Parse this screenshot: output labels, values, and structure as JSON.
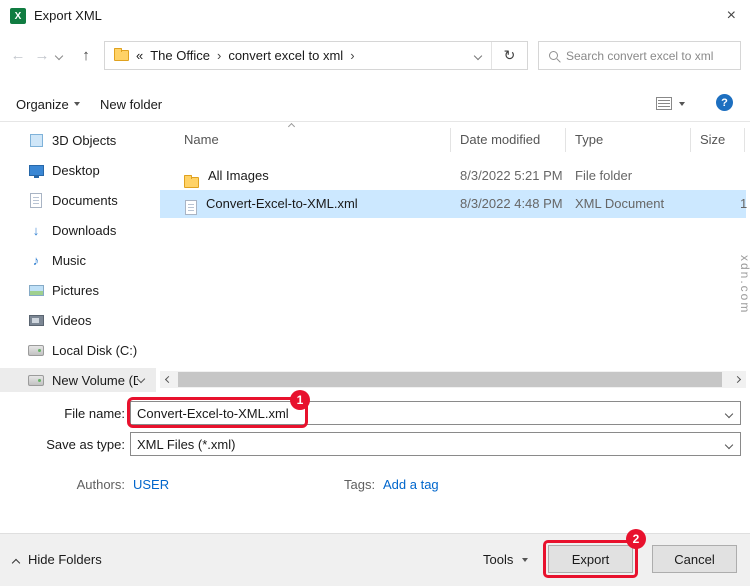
{
  "window": {
    "title": "Export XML"
  },
  "icons": {
    "excel": "X",
    "close": "×",
    "back": "←",
    "forward": "→",
    "up": "↑",
    "refresh": "↻",
    "help": "?",
    "music": "♪",
    "download": "↓"
  },
  "address": {
    "breadcrumb_prefix": "«",
    "crumbs": [
      "The Office",
      "convert excel to xml"
    ],
    "separator": "›"
  },
  "search": {
    "placeholder": "Search convert excel to xml"
  },
  "toolbar": {
    "organize": "Organize",
    "new_folder": "New folder"
  },
  "sidebar": {
    "items": [
      {
        "label": "3D Objects"
      },
      {
        "label": "Desktop"
      },
      {
        "label": "Documents"
      },
      {
        "label": "Downloads"
      },
      {
        "label": "Music"
      },
      {
        "label": "Pictures"
      },
      {
        "label": "Videos"
      },
      {
        "label": "Local Disk (C:)"
      },
      {
        "label": "New Volume (D:"
      }
    ]
  },
  "filelist": {
    "columns": [
      "Name",
      "Date modified",
      "Type",
      "Size"
    ],
    "rows": [
      {
        "name": "All Images",
        "date_modified": "8/3/2022 5:21 PM",
        "type": "File folder",
        "size": ""
      },
      {
        "name": "Convert-Excel-to-XML.xml",
        "date_modified": "8/3/2022 4:48 PM",
        "type": "XML Document",
        "size": "1"
      }
    ]
  },
  "fields": {
    "file_name_label": "File name:",
    "file_name_value": "Convert-Excel-to-XML.xml",
    "save_as_type_label": "Save as type:",
    "save_as_type_value": "XML Files (*.xml)",
    "authors_label": "Authors:",
    "authors_value": "USER",
    "tags_label": "Tags:",
    "tags_add": "Add a tag"
  },
  "footer": {
    "hide_folders": "Hide Folders",
    "tools": "Tools",
    "export": "Export",
    "cancel": "Cancel"
  },
  "annotations": {
    "step1": "1",
    "step2": "2",
    "highlight_color": "#e8112d"
  },
  "watermark": "xdn.com",
  "colors": {
    "selection": "#cce8ff",
    "link": "#0066cc",
    "annotation": "#e8112d"
  }
}
